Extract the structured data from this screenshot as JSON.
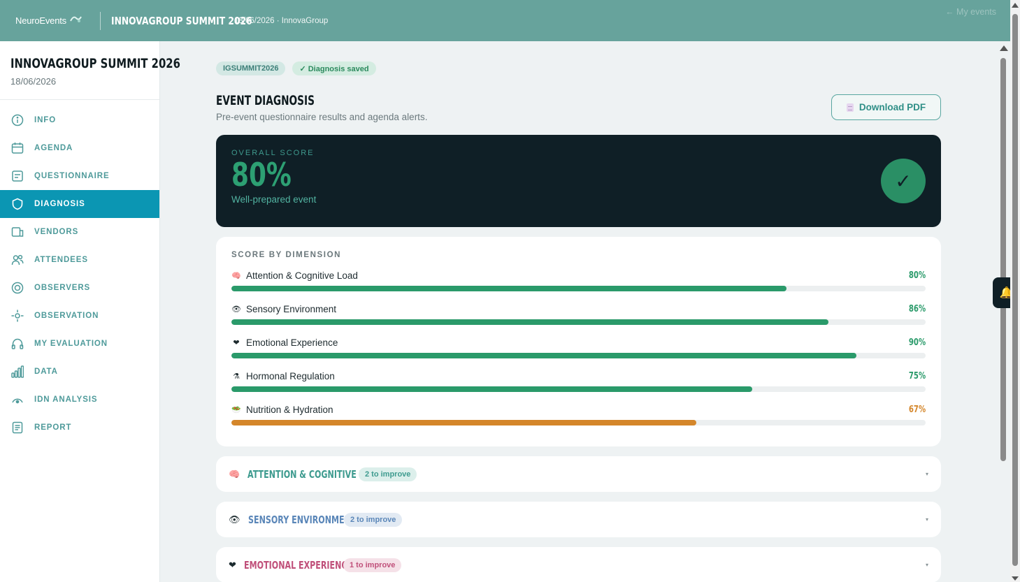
{
  "topbar": {
    "brand": "NeuroEvents",
    "event_title": "INNOVAGROUP SUMMIT 2026",
    "meta": "18/06/2026 · InnovaGroup",
    "back_link": "← My events"
  },
  "sidebar": {
    "title": "INNOVAGROUP SUMMIT 2026",
    "date": "18/06/2026",
    "items": [
      {
        "label": "INFO",
        "icon": "info-icon"
      },
      {
        "label": "AGENDA",
        "icon": "calendar-icon"
      },
      {
        "label": "QUESTIONNAIRE",
        "icon": "form-icon"
      },
      {
        "label": "DIAGNOSIS",
        "icon": "shield-icon",
        "active": true
      },
      {
        "label": "VENDORS",
        "icon": "vendors-icon"
      },
      {
        "label": "ATTENDEES",
        "icon": "users-icon"
      },
      {
        "label": "OBSERVERS",
        "icon": "target-icon"
      },
      {
        "label": "OBSERVATION",
        "icon": "crosshair-icon"
      },
      {
        "label": "MY EVALUATION",
        "icon": "headphones-icon"
      },
      {
        "label": "DATA",
        "icon": "bar-chart-icon"
      },
      {
        "label": "IDN ANALYSIS",
        "icon": "gauge-icon"
      },
      {
        "label": "REPORT",
        "icon": "document-icon"
      }
    ]
  },
  "main": {
    "tag_code": "IGSUMMIT2026",
    "tag_saved": "✓ Diagnosis saved",
    "title": "EVENT DIAGNOSIS",
    "subtitle": "Pre-event questionnaire results and agenda alerts.",
    "download_label": "Download PDF",
    "overall": {
      "label": "OVERALL SCORE",
      "value": "80%",
      "caption": "Well-prepared event",
      "check": "✓"
    },
    "dimensions_heading": "SCORE BY DIMENSION",
    "dimensions": [
      {
        "name": "Attention & Cognitive Load",
        "pct_text": "80%",
        "value": 0.8,
        "emoji": "🧠",
        "color": "#2a9a6a"
      },
      {
        "name": "Sensory Environment",
        "pct_text": "86%",
        "value": 0.86,
        "emoji": "👁",
        "color": "#2a9a6a"
      },
      {
        "name": "Emotional Experience",
        "pct_text": "90%",
        "value": 0.9,
        "emoji": "❤",
        "color": "#2a9a6a"
      },
      {
        "name": "Hormonal Regulation",
        "pct_text": "75%",
        "value": 0.75,
        "emoji": "⚗",
        "color": "#2a9a6a"
      },
      {
        "name": "Nutrition & Hydration",
        "pct_text": "67%",
        "value": 0.67,
        "emoji": "🥗",
        "color": "#d4862a"
      }
    ],
    "accordions": [
      {
        "title": "ATTENTION & COGNITIVE LOAD",
        "badge": "2 to improve",
        "emoji": "🧠",
        "title_color": "#3e9b8f",
        "badge_bg": "#dcefeb",
        "badge_color": "#3e9b8f"
      },
      {
        "title": "SENSORY ENVIRONMENT",
        "badge": "2 to improve",
        "emoji": "👁",
        "title_color": "#5a86b8",
        "badge_bg": "#e2eaf3",
        "badge_color": "#5a86b8"
      },
      {
        "title": "EMOTIONAL EXPERIENCE",
        "badge": "1 to improve",
        "emoji": "❤",
        "title_color": "#c0507a",
        "badge_bg": "#f5e1e8",
        "badge_color": "#c0507a"
      }
    ],
    "caret": "▾"
  },
  "notification": {
    "icon": "bell-icon",
    "glyph": "🔔"
  }
}
